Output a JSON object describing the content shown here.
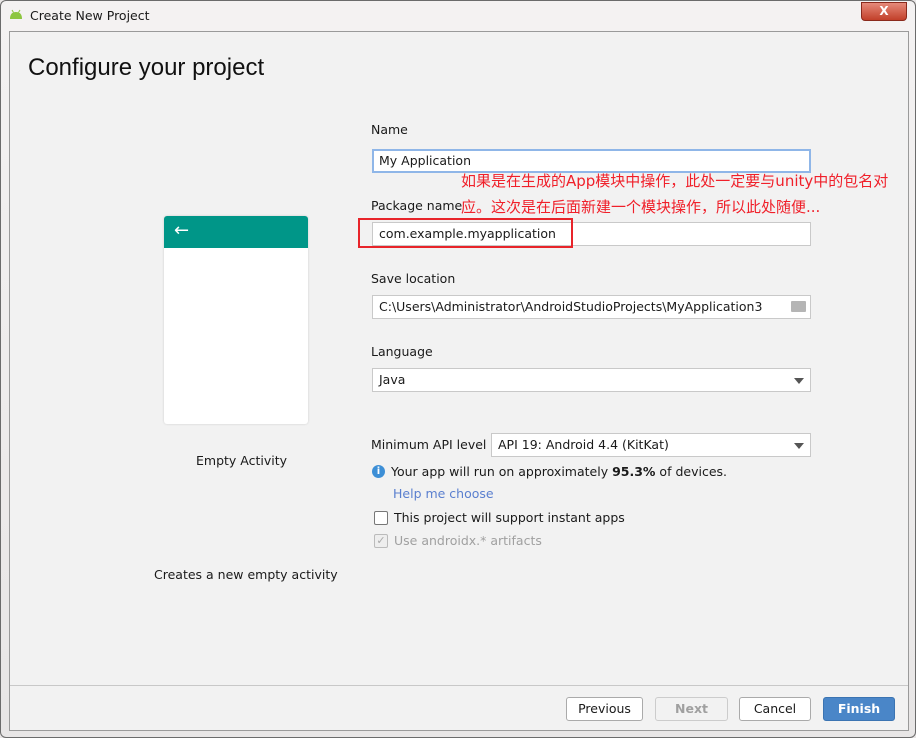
{
  "window": {
    "title": "Create New Project",
    "close_label": "X"
  },
  "heading": "Configure your project",
  "template": {
    "name": "Empty Activity",
    "description": "Creates a new empty activity",
    "back_arrow": "←"
  },
  "form": {
    "name": {
      "label": "Name",
      "value": "My Application"
    },
    "package": {
      "label": "Package name",
      "value": "com.example.myapplication"
    },
    "save_location": {
      "label": "Save location",
      "value": "C:\\Users\\Administrator\\AndroidStudioProjects\\MyApplication3",
      "icon": "folder-icon"
    },
    "language": {
      "label": "Language",
      "value": "Java"
    },
    "min_api": {
      "label": "Minimum API level",
      "value": "API 19: Android 4.4 (KitKat)"
    },
    "info_prefix": "Your app will run on approximately ",
    "info_percent": "95.3%",
    "info_suffix": " of devices.",
    "help_link": "Help me choose",
    "instant_apps": {
      "label": "This project will support instant apps",
      "checked": false
    },
    "androidx": {
      "label": "Use androidx.* artifacts",
      "checked": true,
      "disabled": true
    }
  },
  "annotation": {
    "line1": "如果是在生成的App模块中操作，此处一定要与unity中的包名对",
    "line2": "应。这次是在后面新建一个模块操作，所以此处随便...",
    "color": "#f0202a"
  },
  "buttons": {
    "previous": "Previous",
    "next": "Next",
    "cancel": "Cancel",
    "finish": "Finish"
  },
  "colors": {
    "accent": "#009688",
    "primary_button": "#4a86c8",
    "link": "#5a7fcf"
  }
}
